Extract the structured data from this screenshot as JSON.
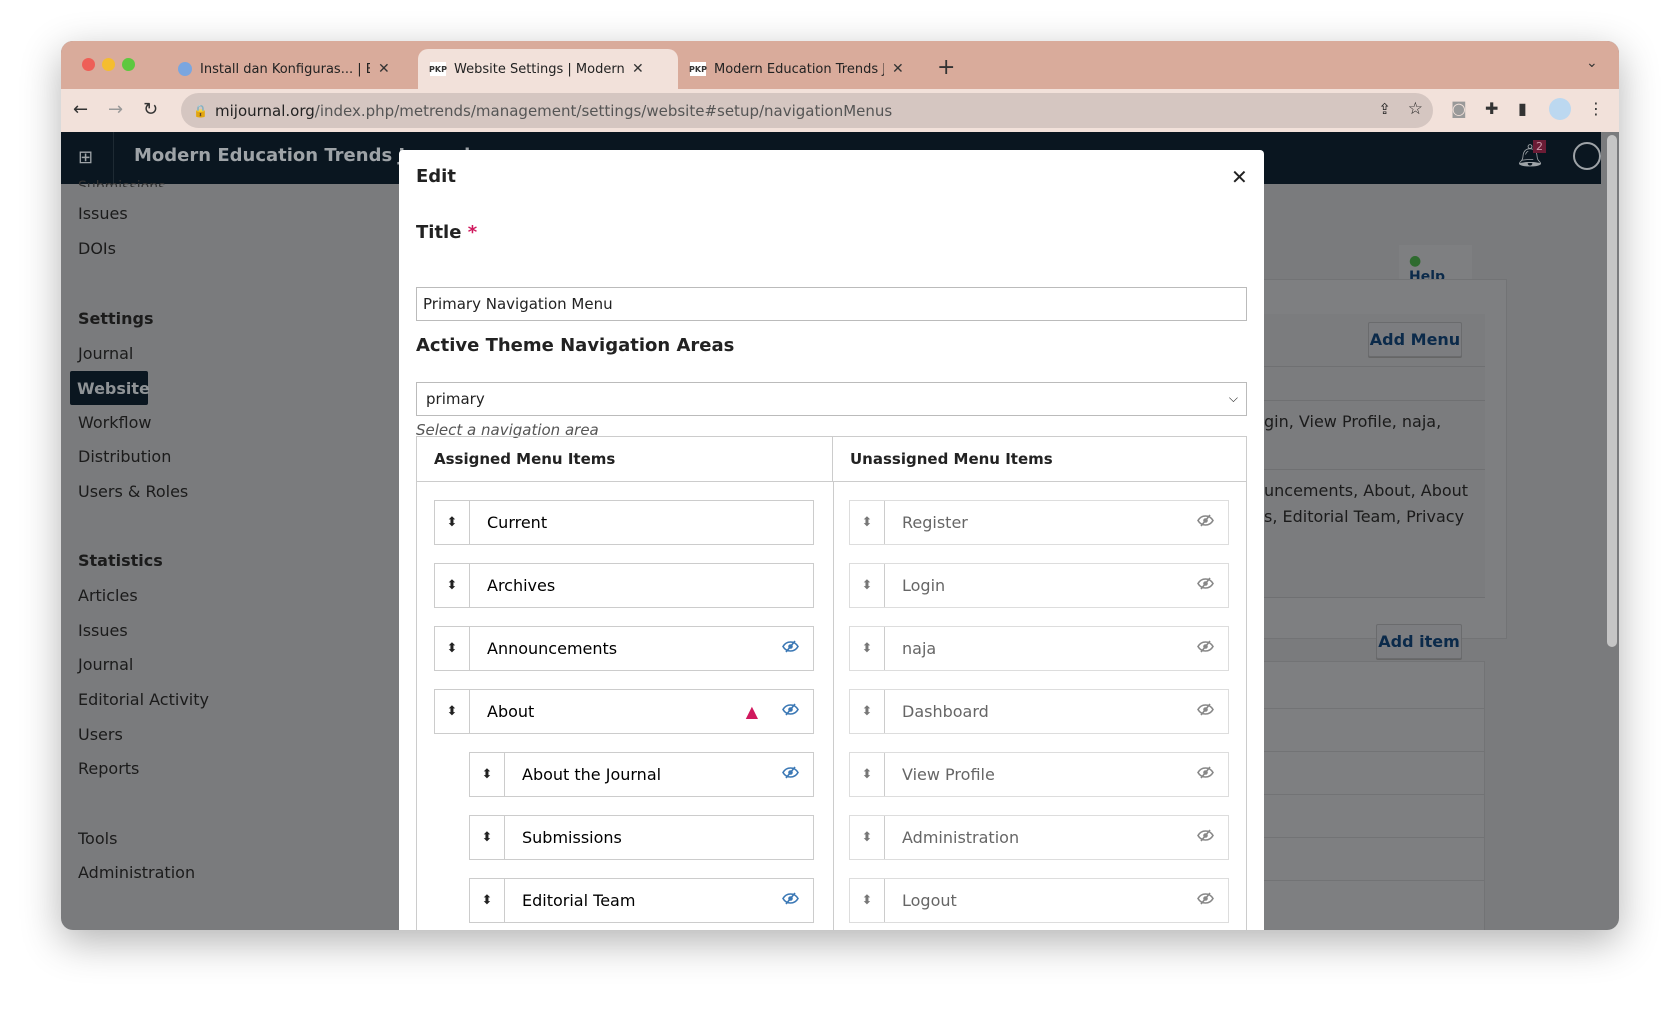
{
  "browser": {
    "tabs": [
      {
        "title": "Install dan Konfiguras... | Book",
        "favicon": "book-icon",
        "active": false
      },
      {
        "title": "Website Settings | Modern Edu",
        "favicon": "PKP",
        "active": true
      },
      {
        "title": "Modern Education Trends Journ",
        "favicon": "PKP",
        "active": false
      }
    ],
    "url_domain": "mijournal.org",
    "url_path": "/index.php/metrends/management/settings/website#setup/navigationMenus"
  },
  "app": {
    "title": "Modern Education Trends Journal",
    "notifications_count": "2",
    "sidebar": {
      "items_top": [
        "Submissions",
        "Issues",
        "DOIs"
      ],
      "settings_heading": "Settings",
      "settings_items": [
        "Journal",
        "Website",
        "Workflow",
        "Distribution",
        "Users & Roles"
      ],
      "active": "Website",
      "statistics_heading": "Statistics",
      "statistics_items": [
        "Articles",
        "Issues",
        "Journal",
        "Editorial Activity",
        "Users",
        "Reports"
      ],
      "other_items": [
        "Tools",
        "Administration"
      ]
    },
    "content": {
      "help_label": "Help",
      "add_menu_label": "Add Menu",
      "menu_row1_text": "gin, View Profile, naja,",
      "menu_row2_line1": "uncements, About, About",
      "menu_row2_line2": "s, Editorial Team, Privacy",
      "add_item_label": "Add item"
    }
  },
  "modal": {
    "heading": "Edit",
    "title_label": "Title",
    "required_mark": "*",
    "title_value": "Primary Navigation Menu",
    "areas_label": "Active Theme Navigation Areas",
    "areas_value": "primary",
    "areas_hint": "Select a navigation area",
    "assigned_header": "Assigned Menu Items",
    "unassigned_header": "Unassigned Menu Items",
    "assigned": [
      {
        "label": "Current",
        "indent": false,
        "warning": false,
        "hidden_icon": false
      },
      {
        "label": "Archives",
        "indent": false,
        "warning": false,
        "hidden_icon": false
      },
      {
        "label": "Announcements",
        "indent": false,
        "warning": false,
        "hidden_icon": true
      },
      {
        "label": "About",
        "indent": false,
        "warning": true,
        "hidden_icon": true
      },
      {
        "label": "About the Journal",
        "indent": true,
        "warning": false,
        "hidden_icon": true
      },
      {
        "label": "Submissions",
        "indent": true,
        "warning": false,
        "hidden_icon": false
      },
      {
        "label": "Editorial Team",
        "indent": true,
        "warning": false,
        "hidden_icon": true
      }
    ],
    "unassigned": [
      "Register",
      "Login",
      "naja",
      "Dashboard",
      "View Profile",
      "Administration",
      "Logout"
    ]
  },
  "colors": {
    "accent": "#3b78b5",
    "warning": "#d0195e",
    "header": "#0a1620",
    "tabbar": "#d9ab9b"
  }
}
